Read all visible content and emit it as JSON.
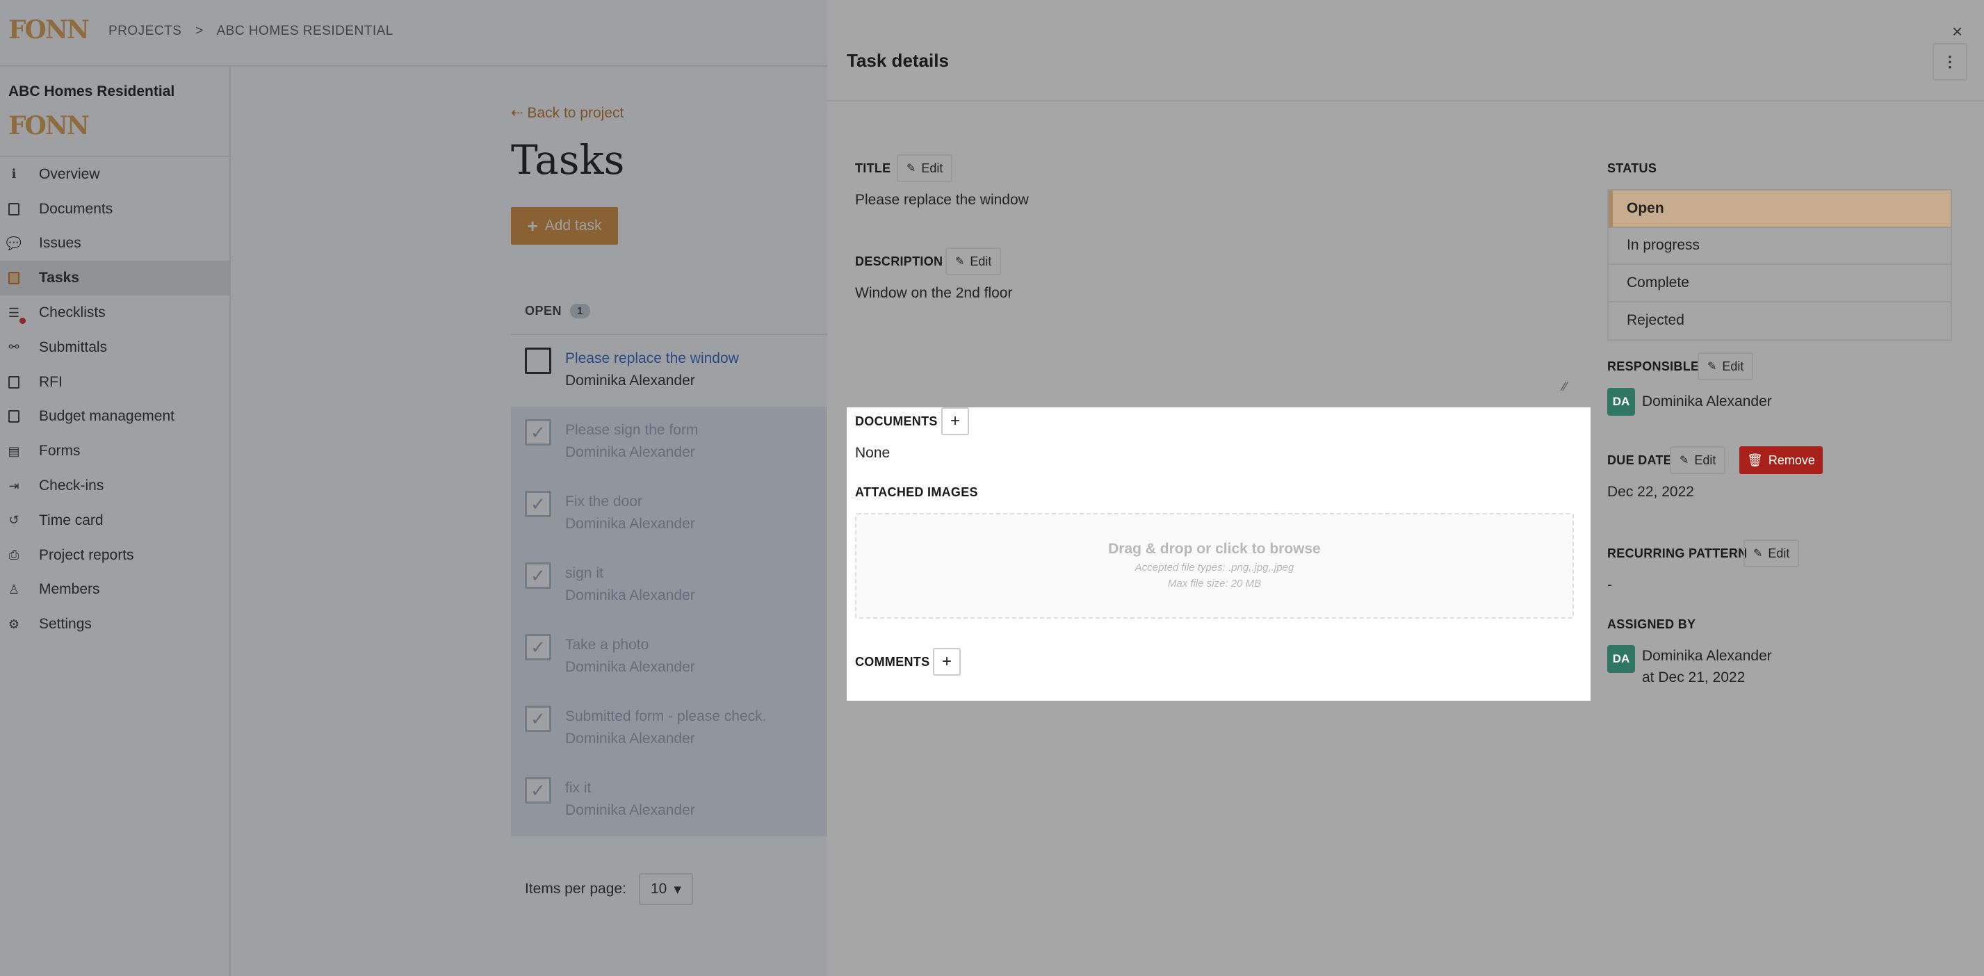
{
  "brand": {
    "logo_text": "FONN",
    "accent": "#d98c33"
  },
  "breadcrumb": {
    "projects": "PROJECTS",
    "separator": ">",
    "current": "ABC HOMES RESIDENTIAL"
  },
  "sidebar": {
    "project_name": "ABC Homes Residential",
    "items": [
      {
        "label": "Overview",
        "icon": "info-icon"
      },
      {
        "label": "Documents",
        "icon": "document-icon"
      },
      {
        "label": "Issues",
        "icon": "chat-icon"
      },
      {
        "label": "Tasks",
        "icon": "clipboard-icon",
        "active": true
      },
      {
        "label": "Checklists",
        "icon": "list-icon",
        "badge_dot": true
      },
      {
        "label": "Submittals",
        "icon": "flow-icon"
      },
      {
        "label": "RFI",
        "icon": "rfi-icon"
      },
      {
        "label": "Budget management",
        "icon": "wallet-icon"
      },
      {
        "label": "Forms",
        "icon": "form-icon"
      },
      {
        "label": "Check-ins",
        "icon": "login-icon"
      },
      {
        "label": "Time card",
        "icon": "history-icon"
      },
      {
        "label": "Project reports",
        "icon": "printer-icon"
      },
      {
        "label": "Members",
        "icon": "user-icon"
      },
      {
        "label": "Settings",
        "icon": "gear-icon"
      }
    ]
  },
  "tasks_page": {
    "back_link": "⇠ Back to project",
    "title": "Tasks",
    "add_task_label": "Add task",
    "open_label": "OPEN",
    "open_count": "1",
    "tasks": [
      {
        "title": "Please replace the window",
        "assignee": "Dominika Alexander",
        "done": false
      },
      {
        "title": "Please sign the form",
        "assignee": "Dominika Alexander",
        "done": true
      },
      {
        "title": "Fix the door",
        "assignee": "Dominika Alexander",
        "done": true
      },
      {
        "title": "sign it",
        "assignee": "Dominika Alexander",
        "done": true
      },
      {
        "title": "Take a photo",
        "assignee": "Dominika Alexander",
        "done": true
      },
      {
        "title": "Submitted form - please check.",
        "assignee": "Dominika Alexander",
        "done": true
      },
      {
        "title": "fix it",
        "assignee": "Dominika Alexander",
        "done": true
      }
    ],
    "items_per_page_label": "Items per page:",
    "items_per_page_value": "10"
  },
  "drawer": {
    "title": "Task details",
    "close": "×",
    "menu": "⋮",
    "edit_label": "Edit",
    "title_label": "TITLE",
    "title_value": "Please replace the window",
    "description_label": "DESCRIPTION",
    "description_value": "Window on the 2nd floor",
    "documents_label": "DOCUMENTS",
    "documents_value": "None",
    "attached_images_label": "ATTACHED IMAGES",
    "dropzone": {
      "main": "Drag & drop or click to browse",
      "types": "Accepted file types: .png,.jpg,.jpeg",
      "max": "Max file size: 20 MB"
    },
    "comments_label": "COMMENTS",
    "status_label": "STATUS",
    "statuses": [
      "Open",
      "In progress",
      "Complete",
      "Rejected"
    ],
    "selected_status": "Open",
    "responsible_label": "RESPONSIBLE",
    "responsible": {
      "initials": "DA",
      "name": "Dominika Alexander"
    },
    "due_date_label": "DUE DATE",
    "remove_label": "Remove",
    "due_date_value": "Dec 22, 2022",
    "recurring_label": "RECURRING PATTERN",
    "recurring_value": "-",
    "assigned_by_label": "ASSIGNED BY",
    "assigned_by": {
      "initials": "DA",
      "name": "Dominika Alexander",
      "date": "at Dec 21, 2022"
    }
  }
}
